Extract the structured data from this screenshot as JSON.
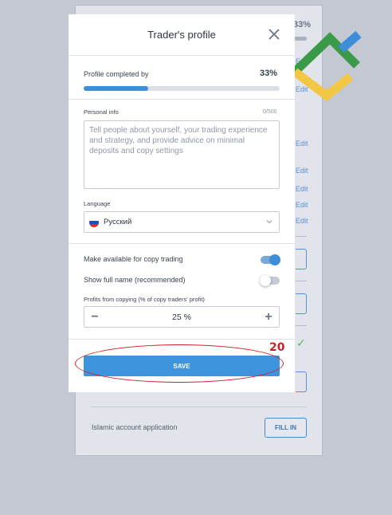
{
  "background": {
    "profile_pct": "33%",
    "edit_links": [
      "Edit",
      "Edit",
      "Edit",
      "Edit",
      "Edit",
      "Edit",
      "Edit"
    ],
    "islamic_label": "Islamic account application",
    "fill_in_label": "FILL IN"
  },
  "modal": {
    "title": "Trader's profile",
    "profile": {
      "label": "Profile completed by",
      "percent_text": "33%",
      "percent": 33
    },
    "personal_info": {
      "label": "Personal info",
      "counter": "0/500",
      "placeholder": "Tell people about yourself, your trading experience and strategy, and provide advice on minimal deposits and copy settings"
    },
    "language": {
      "label": "Language",
      "value": "Русский",
      "flag_colors": [
        "#ffffff",
        "#1d4fbf",
        "#d52b2b"
      ]
    },
    "copy_trading": {
      "label": "Make available for copy trading",
      "enabled": true
    },
    "full_name": {
      "label": "Show full name (recommended)",
      "enabled": false
    },
    "profits": {
      "label": "Profits from copying (% of copy traders' profit)",
      "value": "25 %",
      "minus": "−",
      "plus": "+"
    },
    "save_label": "SAVE"
  },
  "annotation": {
    "number": "20",
    "color": "#cf1f2a"
  },
  "colors": {
    "accent": "#3d94dc",
    "logo_green": "#3b9a47",
    "logo_blue": "#3d8dd9",
    "logo_yellow": "#f2c744"
  }
}
